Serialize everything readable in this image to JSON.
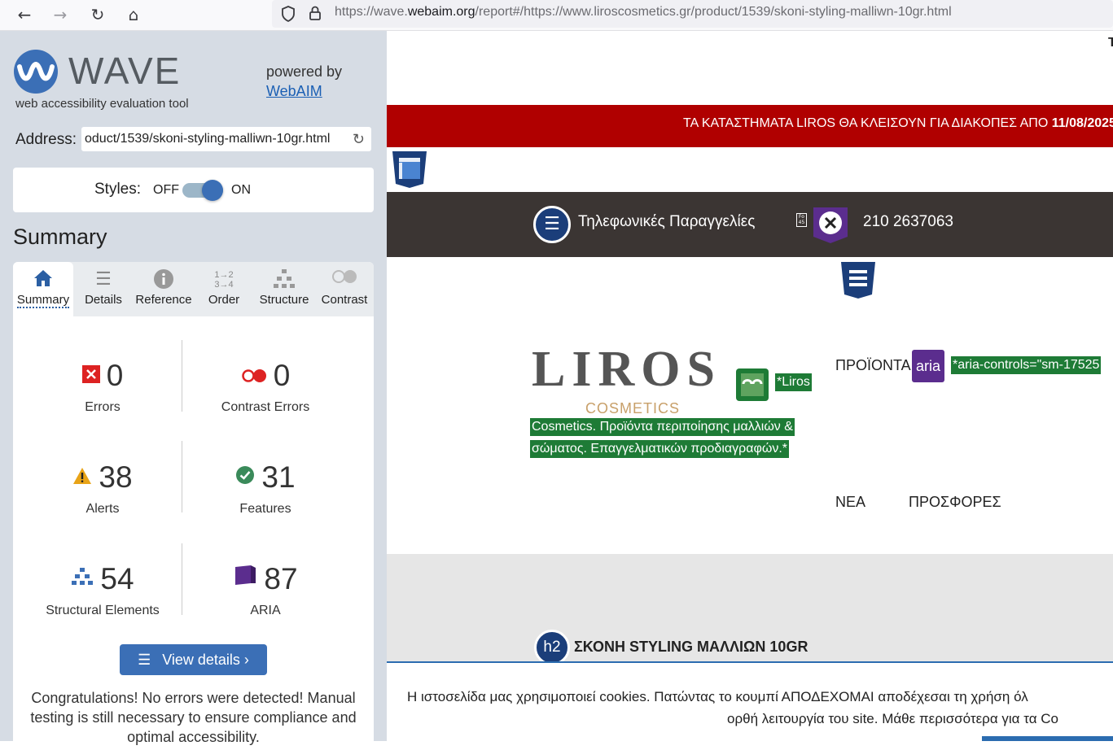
{
  "browser": {
    "url_prefix": "https://wave.",
    "url_domain": "webaim.org",
    "url_rest": "/report#/https://www.liroscosmetics.gr/product/1539/skoni-styling-malliwn-10gr.html"
  },
  "wave": {
    "title": "WAVE",
    "subtitle": "web accessibility evaluation tool",
    "powered_by": "powered by",
    "webaim_link": "WebAIM",
    "address_label": "Address:",
    "address_value": "oduct/1539/skoni-styling-malliwn-10gr.html",
    "styles_label": "Styles:",
    "styles_off": "OFF",
    "styles_on": "ON",
    "summary_heading": "Summary",
    "tabs": [
      {
        "label": "Summary",
        "icon": "home-icon"
      },
      {
        "label": "Details",
        "icon": "list-icon"
      },
      {
        "label": "Reference",
        "icon": "info-icon"
      },
      {
        "label": "Order",
        "icon": "order-icon"
      },
      {
        "label": "Structure",
        "icon": "structure-icon"
      },
      {
        "label": "Contrast",
        "icon": "contrast-icon"
      }
    ],
    "stats": {
      "errors": {
        "value": "0",
        "label": "Errors"
      },
      "contrast_errors": {
        "value": "0",
        "label": "Contrast Errors"
      },
      "alerts": {
        "value": "38",
        "label": "Alerts"
      },
      "features": {
        "value": "31",
        "label": "Features"
      },
      "structural": {
        "value": "54",
        "label": "Structural Elements"
      },
      "aria": {
        "value": "87",
        "label": "ARIA"
      }
    },
    "view_details": "View details ›",
    "congrats": "Congratulations! No errors were detected! Manual testing is still necessary to ensure compliance and optimal accessibility."
  },
  "site": {
    "top_right_char": "T",
    "banner_text": "ΤΑ ΚΑΤΑΣΤΗΜΑΤΑ LIROS ΘΑ ΚΛΕΙΣΟΥΝ ΓΙΑ ΔΙΑΚΟΠΕΣ ΑΠΟ ",
    "banner_date": "11/08/2025",
    "phone_orders": "Τηλεφωνικές Παραγγελίες",
    "phone_number": "210 2637063",
    "logo_main": "LIROS",
    "logo_sub": "COSMETICS",
    "alt_label_1": "*Liros",
    "alt_label_2": "Cosmetics. Προϊόντα περιποίησης μαλλιών &",
    "alt_label_3": "σώματος. Επαγγελματικών προδιαγραφών.*",
    "nav_products": "ΠΡΟΪΟΝΤΑ",
    "aria_badge": "aria",
    "aria_controls": "*aria-controls=\"sm-17525",
    "nav_new": "ΝΕΑ",
    "nav_offers": "ΠΡΟΣΦΟΡΕΣ",
    "h2_badge": "h2",
    "product_title": "ΣΚΟΝΗ STYLING ΜΑΛΛΙΩΝ 10GR",
    "cookie_line1": "Η ιστοσελίδα μας χρησιμοποιεί cookies. Πατώντας το κουμπί ΑΠΟΔΕΧΟΜΑΙ αποδέχεσαι τη χρήση όλ",
    "cookie_line2": "ορθή λειτουργία του site. Μάθε περισσότερα για τα Co"
  }
}
